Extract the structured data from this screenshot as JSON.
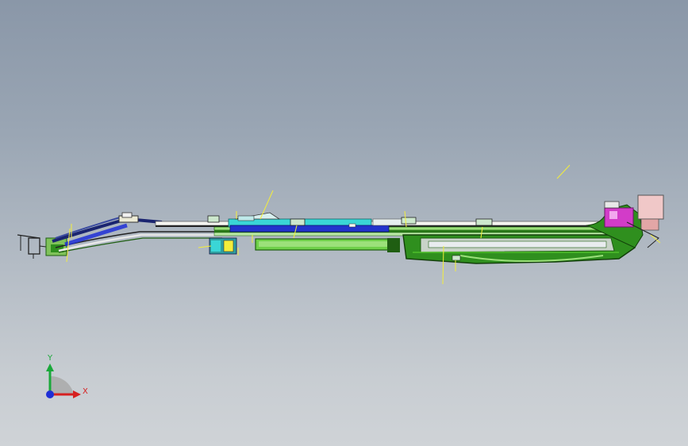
{
  "app": {
    "title": "",
    "view": "3D CAD viewport"
  },
  "triad": {
    "x_label": "X",
    "y_label": "Y",
    "icon": "coordinate-triad-icon",
    "colors": {
      "x": "#d62020",
      "y": "#1aa83a",
      "z": "#1f2fd6"
    }
  },
  "model": {
    "icon": "assembly-model-icon",
    "colors": {
      "dark_green": "#1f5e12",
      "green": "#4fbf2a",
      "light_green": "#9be07a",
      "blue": "#2233cc",
      "cyan": "#3ad6d6",
      "magenta": "#d23cc8",
      "pink": "#f0c8c8",
      "yellow": "#f4ee3a",
      "navy": "#1a2470"
    }
  }
}
